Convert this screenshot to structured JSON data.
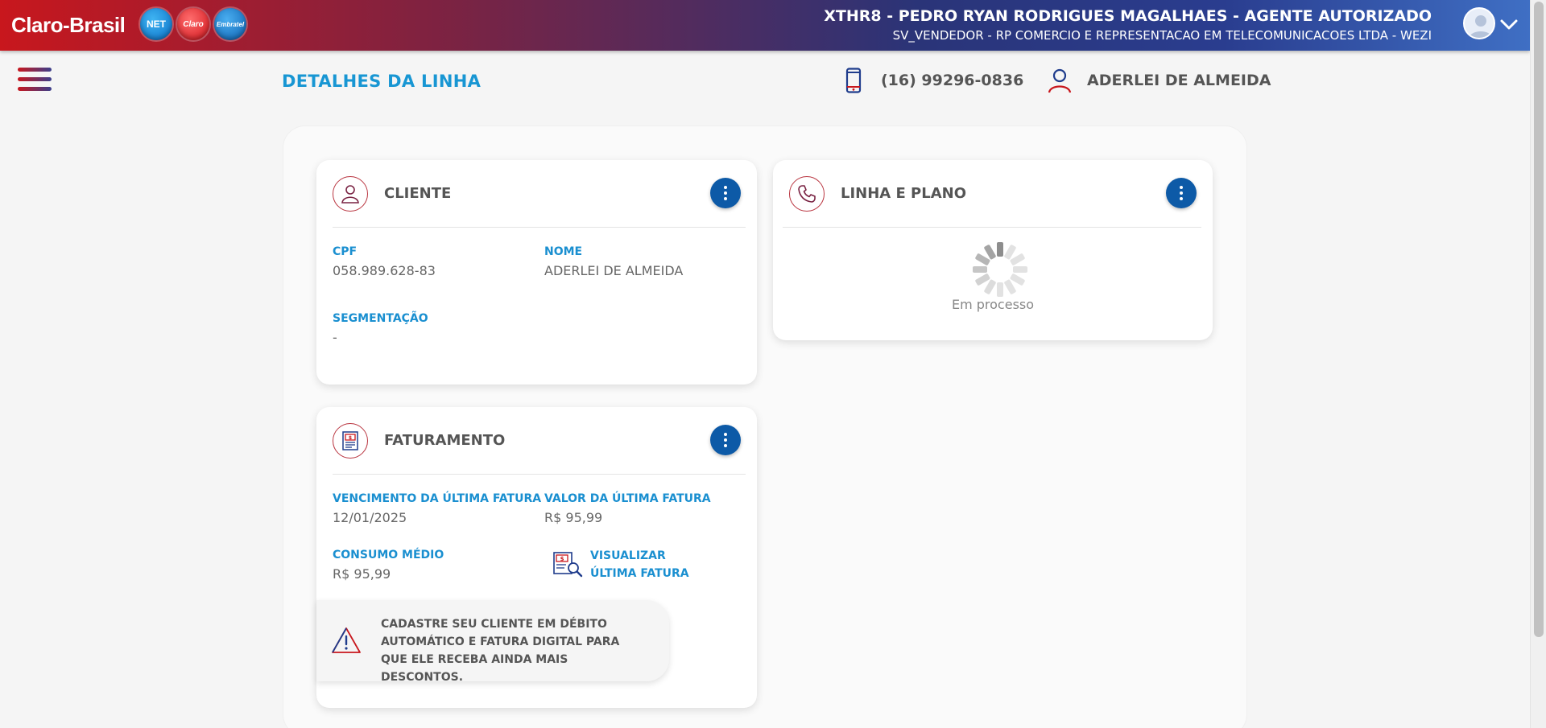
{
  "header": {
    "brand": "Claro-Brasil",
    "logos": [
      "NET",
      "Claro",
      "Embratel"
    ],
    "user_line1": "XTHR8 - PEDRO RYAN RODRIGUES MAGALHAES - AGENTE AUTORIZADO",
    "user_line2": "SV_VENDEDOR - RP COMERCIO E REPRESENTACAO EM TELECOMUNICACOES LTDA - WEZI"
  },
  "subheader": {
    "title": "DETALHES DA LINHA",
    "phone": "(16) 99296-0836",
    "customer": "ADERLEI DE ALMEIDA"
  },
  "cliente": {
    "title": "CLIENTE",
    "cpf_label": "CPF",
    "cpf_value": "058.989.628-83",
    "nome_label": "NOME",
    "nome_value": "ADERLEI DE ALMEIDA",
    "segmentacao_label": "SEGMENTAÇÃO",
    "segmentacao_value": "-"
  },
  "linha_plano": {
    "title": "LINHA E PLANO",
    "status": "Em processo"
  },
  "faturamento": {
    "title": "FATURAMENTO",
    "vencimento_label": "VENCIMENTO DA ÚLTIMA FATURA",
    "vencimento_value": "12/01/2025",
    "valor_label": "VALOR DA ÚLTIMA FATURA",
    "valor_value": "R$ 95,99",
    "consumo_label": "CONSUMO MÉDIO",
    "consumo_value": "R$ 95,99",
    "link_label": "VISUALIZAR ÚLTIMA FATURA",
    "alert_text": "CADASTRE SEU CLIENTE EM DÉBITO AUTOMÁTICO E FATURA DIGITAL PARA QUE ELE RECEBA AINDA MAIS DESCONTOS."
  },
  "colors": {
    "accent_blue": "#1a8fd0",
    "button_blue": "#0d5aa7",
    "brand_red": "#c8171d"
  }
}
